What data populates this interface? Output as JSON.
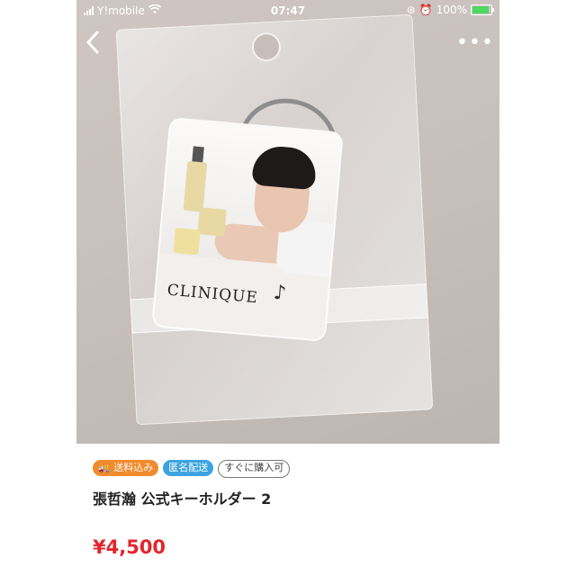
{
  "status_bar": {
    "carrier": "Y!mobile",
    "time": "07:47",
    "battery_percent": "100%",
    "icons": [
      "signal-icon",
      "wifi-icon",
      "orientation-lock-icon",
      "alarm-icon",
      "battery-icon"
    ]
  },
  "nav": {
    "back_icon": "chevron-left-icon",
    "more_icon": "more-dots-icon"
  },
  "product_image": {
    "brand_text": "CLINIQUE"
  },
  "badges": {
    "shipping": "送料込み",
    "anonymous": "匿名配送",
    "buy_now": "すぐに購入可"
  },
  "product": {
    "title": "張哲瀚 公式キーホルダー 2",
    "price": "¥4,500"
  },
  "colors": {
    "price": "#e3262d",
    "shipping_badge": "#f28a2e",
    "anonymous_badge": "#3ca3e0"
  }
}
